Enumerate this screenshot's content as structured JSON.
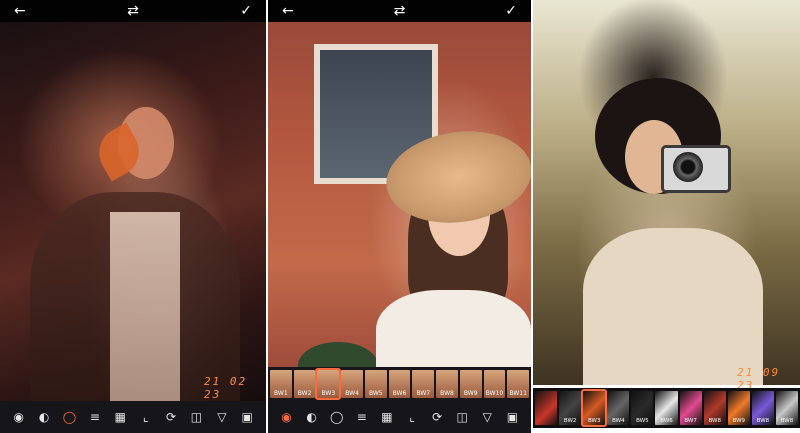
{
  "accent_color": "#ff6a3a",
  "panels": [
    {
      "topbar": {
        "back_icon": "arrow-left-icon",
        "shuffle_icon": "shuffle-icon",
        "confirm_icon": "check-icon"
      },
      "date_stamp": "21 02 23",
      "toolbar": [
        "palette-icon",
        "contrast-icon",
        "filter-icon",
        "sliders-icon",
        "calendar-icon",
        "crop-icon",
        "rotate-icon",
        "perspective-icon",
        "vignette-icon",
        "frame-icon"
      ]
    },
    {
      "topbar": {
        "back_icon": "arrow-left-icon",
        "shuffle_icon": "shuffle-icon",
        "confirm_icon": "check-icon"
      },
      "filters": [
        "BW1",
        "BW2",
        "BW3",
        "BW4",
        "BW5",
        "BW6",
        "BW7",
        "BW8",
        "BW9",
        "BW10",
        "BW11"
      ],
      "selected_filter": "BW3",
      "toolbar": [
        "palette-icon",
        "contrast-icon",
        "filter-icon",
        "sliders-icon",
        "calendar-icon",
        "crop-icon",
        "rotate-icon",
        "perspective-icon",
        "vignette-icon",
        "frame-icon"
      ]
    },
    {
      "date_stamp": "21 09 23",
      "filters": [
        "",
        "BW2",
        "BW3",
        "BW4",
        "BW5",
        "BW6",
        "BW7",
        "BW8",
        "BW9",
        "BW8",
        "BW8"
      ],
      "selected_filter": "BW3"
    }
  ]
}
